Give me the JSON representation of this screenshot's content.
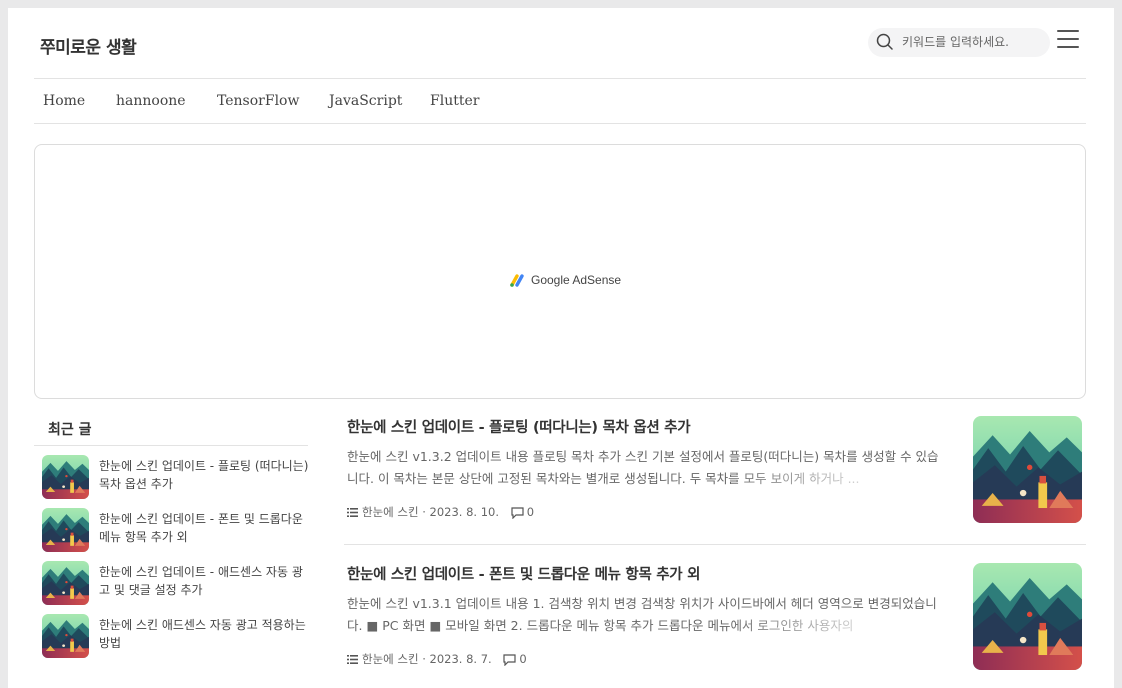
{
  "header": {
    "blog_title": "쭈미로운 생활",
    "search_placeholder": "키워드를 입력하세요."
  },
  "nav": {
    "items": [
      {
        "label": "Home"
      },
      {
        "label": "hannoone"
      },
      {
        "label": "TensorFlow"
      },
      {
        "label": "JavaScript"
      },
      {
        "label": "Flutter"
      }
    ]
  },
  "ad": {
    "label": "Google AdSense",
    "logo_colors": [
      "#fbbc04",
      "#4285f4",
      "#34a853"
    ]
  },
  "sidebar": {
    "title": "최근 글",
    "items": [
      {
        "title": "한눈에 스킨 업데이트 - 플로팅 (떠다니는) 목차 옵션 추가"
      },
      {
        "title": "한눈에 스킨 업데이트 - 폰트 및 드롭다운 메뉴 항목 추가 외"
      },
      {
        "title": "한눈에 스킨 업데이트 - 애드센스 자동 광고 및 댓글 설정 추가"
      },
      {
        "title": "한눈에 스킨 애드센스 자동 광고 적용하는 방법"
      }
    ]
  },
  "posts": [
    {
      "title": "한눈에 스킨 업데이트 - 플로팅 (떠다니는) 목차 옵션 추가",
      "excerpt": "한눈에 스킨 v1.3.2 업데이트 내용 플로팅 목차 추가 스킨 기본 설정에서 플로팅(떠다니는) 목차를 생성할 수 있습니다. 이 목차는 본문 상단에 고정된 목차와는 별개로 생성됩니다. 두 목차를 모두 보이게 하거나 ...",
      "category": "한눈에 스킨",
      "date": "2023. 8. 10.",
      "comments": "0"
    },
    {
      "title": "한눈에 스킨 업데이트 - 폰트 및 드롭다운 메뉴 항목 추가 외",
      "excerpt": "한눈에 스킨 v1.3.1 업데이트 내용 1. 검색창 위치 변경 검색창 위치가 사이드바에서 헤더 영역으로 변경되었습니다. ■ PC 화면 ■ 모바일 화면 2. 드롭다운 메뉴 항목 추가 드롭다운 메뉴에서 로그인한 사용자의",
      "category": "한눈에 스킨",
      "date": "2023. 8. 7.",
      "comments": "0"
    }
  ],
  "colors": {
    "sky": "#7fd8a8",
    "mountain_dark": "#1f4a5c",
    "ground": "#c23a4a"
  }
}
